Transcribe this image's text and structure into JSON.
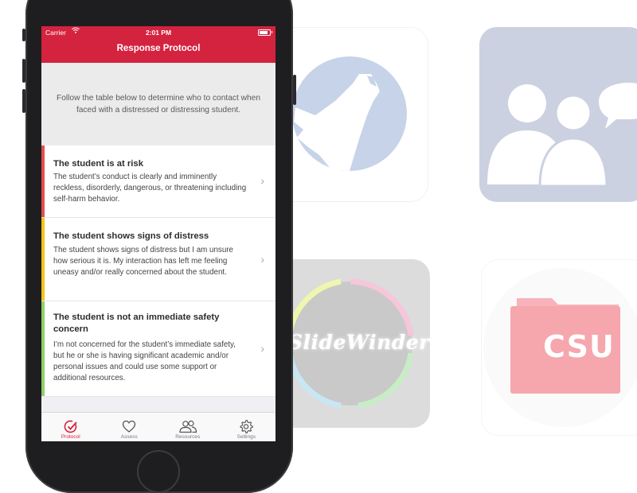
{
  "status_bar": {
    "carrier": "Carrier",
    "time": "2:01 PM"
  },
  "nav": {
    "title": "Response Protocol"
  },
  "intro_text": "Follow the table below to determine who to contact when faced with a distressed or distressing student.",
  "rows": [
    {
      "title": "The student is at risk",
      "description": "The student’s conduct is clearly and imminently reckless, disorderly, dangerous, or threatening including self-harm behavior.",
      "color": "#e74c4c"
    },
    {
      "title": "The student shows signs of distress",
      "description": "The student shows signs of distress but I am unsure how serious it is. My interaction has left me feeling uneasy and/or really concerned about the student.",
      "color": "#f2c417"
    },
    {
      "title": "The student is not an immediate safety concern",
      "description": "I’m not concerned for the student’s immediate safety, but he or she is having significant academic and/or personal issues and could use some support or additional resources.",
      "color": "#8fd06b"
    }
  ],
  "tabs": [
    {
      "label": "Protocol",
      "icon": "check-circle-icon",
      "active": true
    },
    {
      "label": "Assess",
      "icon": "heart-icon",
      "active": false
    },
    {
      "label": "Resources",
      "icon": "people-icon",
      "active": false
    },
    {
      "label": "Settings",
      "icon": "gear-icon",
      "active": false
    }
  ],
  "background_apps": [
    {
      "name": "wolf-app",
      "color": "#c6d3e8"
    },
    {
      "name": "users-chat-app",
      "color": "#cbd1e0"
    },
    {
      "name": "slidewinder-app",
      "label": "SlideWinder",
      "color": "#dcdcdc"
    },
    {
      "name": "csu-app",
      "label": "CSU",
      "color": "#f6a6ad"
    }
  ],
  "colors": {
    "accent": "#d4233f",
    "background": "#efeff4"
  }
}
